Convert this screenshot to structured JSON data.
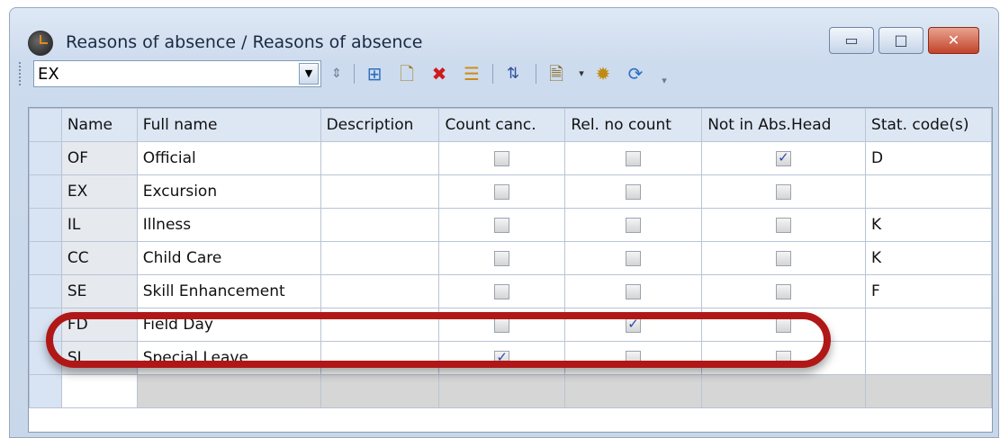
{
  "window": {
    "title": "Reasons of absence / Reasons of absence",
    "icon": "clock-icon",
    "buttons": {
      "minimize": "▭",
      "maximize": "□",
      "close": "✕"
    }
  },
  "toolbar": {
    "combo_value": "EX",
    "icons": [
      "spin-updown-icon",
      "form-view-icon",
      "new-record-icon",
      "delete-icon",
      "list-icon",
      "sort-icon",
      "print-preview-icon",
      "settings-icon",
      "refresh-icon",
      "toolbar-options-icon"
    ]
  },
  "table": {
    "columns": [
      "Name",
      "Full name",
      "Description",
      "Count canc.",
      "Rel. no count",
      "Not in Abs.Head",
      "Stat. code(s)"
    ],
    "rows": [
      {
        "name": "OF",
        "full_name": "Official",
        "description": "",
        "count_canc": false,
        "rel_no_count": false,
        "not_in_abs_head": true,
        "stat_codes": "D"
      },
      {
        "name": "EX",
        "full_name": "Excursion",
        "description": "",
        "count_canc": false,
        "rel_no_count": false,
        "not_in_abs_head": false,
        "stat_codes": ""
      },
      {
        "name": "IL",
        "full_name": "Illness",
        "description": "",
        "count_canc": false,
        "rel_no_count": false,
        "not_in_abs_head": false,
        "stat_codes": "K"
      },
      {
        "name": "CC",
        "full_name": "Child Care",
        "description": "",
        "count_canc": false,
        "rel_no_count": false,
        "not_in_abs_head": false,
        "stat_codes": "K"
      },
      {
        "name": "SE",
        "full_name": "Skill Enhancement",
        "description": "",
        "count_canc": false,
        "rel_no_count": false,
        "not_in_abs_head": false,
        "stat_codes": "F"
      },
      {
        "name": "FD",
        "full_name": "Field Day",
        "description": "",
        "count_canc": false,
        "rel_no_count": true,
        "not_in_abs_head": false,
        "stat_codes": ""
      },
      {
        "name": "SL",
        "full_name": "Special Leave",
        "description": "",
        "count_canc": true,
        "rel_no_count": false,
        "not_in_abs_head": false,
        "stat_codes": ""
      }
    ]
  },
  "colors": {
    "highlight": "#b01818",
    "header_bg": "#dde7f4"
  }
}
